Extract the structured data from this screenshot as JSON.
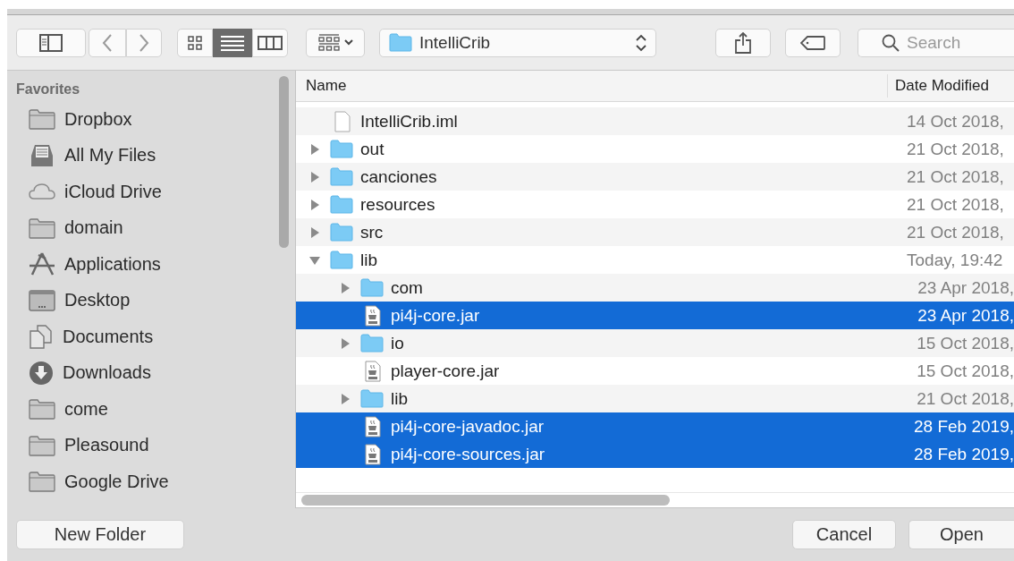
{
  "toolbar": {
    "view_modes": [
      {
        "kind": "icons",
        "selected": false
      },
      {
        "kind": "list",
        "selected": true
      },
      {
        "kind": "columns",
        "selected": false
      }
    ],
    "location": "IntelliCrib",
    "search": {
      "placeholder": "Search"
    }
  },
  "sidebar": {
    "heading": "Favorites",
    "items": [
      {
        "label": "Dropbox",
        "kind": "folder"
      },
      {
        "label": "All My Files",
        "kind": "files"
      },
      {
        "label": "iCloud Drive",
        "kind": "cloud"
      },
      {
        "label": "domain",
        "kind": "folder"
      },
      {
        "label": "Applications",
        "kind": "apps"
      },
      {
        "label": "Desktop",
        "kind": "desktop"
      },
      {
        "label": "Documents",
        "kind": "documents"
      },
      {
        "label": "Downloads",
        "kind": "downloads"
      },
      {
        "label": "come",
        "kind": "folder"
      },
      {
        "label": "Pleasound",
        "kind": "folder"
      },
      {
        "label": "Google Drive",
        "kind": "folder"
      }
    ]
  },
  "table": {
    "columns": [
      "Name",
      "Date Modified"
    ],
    "rows": [
      {
        "name": "IntelliCrib.iml",
        "date": "14 Oct 2018,",
        "kind": "file",
        "selected": false
      },
      {
        "name": "out",
        "date": "21 Oct 2018,",
        "kind": "folder",
        "expanded": false,
        "selected": false
      },
      {
        "name": "canciones",
        "date": "21 Oct 2018,",
        "kind": "folder",
        "expanded": false,
        "selected": false
      },
      {
        "name": "resources",
        "date": "21 Oct 2018,",
        "kind": "folder",
        "expanded": false,
        "selected": false
      },
      {
        "name": "src",
        "date": "21 Oct 2018,",
        "kind": "folder",
        "expanded": false,
        "selected": false
      },
      {
        "name": "lib",
        "date": "Today, 19:42",
        "kind": "folder",
        "expanded": true,
        "selected": false,
        "children": [
          {
            "name": "com",
            "date": "23 Apr 2018,",
            "kind": "folder",
            "expanded": false,
            "selected": false
          },
          {
            "name": "pi4j-core.jar",
            "date": "23 Apr 2018,",
            "kind": "jar",
            "selected": true
          },
          {
            "name": "io",
            "date": "15 Oct 2018,",
            "kind": "folder",
            "expanded": false,
            "selected": false
          },
          {
            "name": "player-core.jar",
            "date": "15 Oct 2018,",
            "kind": "jar",
            "selected": false
          },
          {
            "name": "lib",
            "date": "21 Oct 2018,",
            "kind": "folder",
            "expanded": false,
            "selected": false
          },
          {
            "name": "pi4j-core-javadoc.jar",
            "date": "28 Feb 2019,",
            "kind": "jar",
            "selected": true
          },
          {
            "name": "pi4j-core-sources.jar",
            "date": "28 Feb 2019,",
            "kind": "jar",
            "selected": true
          }
        ]
      }
    ]
  },
  "buttons": {
    "new_folder": "New Folder",
    "cancel": "Cancel",
    "open": "Open"
  }
}
